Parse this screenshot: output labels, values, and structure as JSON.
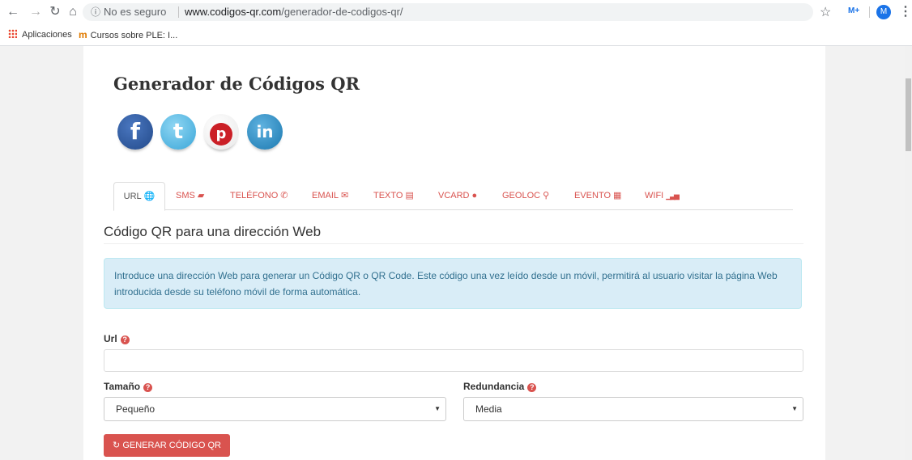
{
  "browser": {
    "security_label": "No es seguro",
    "url_host": "www.codigos-qr.com",
    "url_path": "/generador-de-codigos-qr/",
    "avatar_letter": "M",
    "bookmarks": [
      {
        "label": "Aplicaciones",
        "icon": "apps-icon"
      },
      {
        "label": "Cursos sobre PLE: I...",
        "icon": "ple-icon"
      }
    ]
  },
  "page": {
    "title": "Generador de Códigos QR",
    "social": [
      "facebook-icon",
      "twitter-icon",
      "pinterest-icon",
      "linkedin-icon"
    ],
    "tabs": [
      {
        "label": "URL",
        "icon": "globe-icon",
        "glyph": "🌐",
        "active": true
      },
      {
        "label": "SMS",
        "icon": "comment-icon",
        "glyph": "▰"
      },
      {
        "label": "TELÉFONO",
        "icon": "phone-icon",
        "glyph": "✆"
      },
      {
        "label": "EMAIL",
        "icon": "envelope-icon",
        "glyph": "✉"
      },
      {
        "label": "TEXTO",
        "icon": "list-icon",
        "glyph": "▤"
      },
      {
        "label": "VCARD",
        "icon": "user-icon",
        "glyph": "●"
      },
      {
        "label": "GEOLOC",
        "icon": "map-marker-icon",
        "glyph": "⚲"
      },
      {
        "label": "EVENTO",
        "icon": "calendar-icon",
        "glyph": "▦"
      },
      {
        "label": "WIFI",
        "icon": "signal-icon",
        "glyph": "▁▃▅"
      }
    ],
    "section_title": "Código QR para una dirección Web",
    "info_text": "Introduce una dirección Web para generar un Código QR o QR Code. Este código una vez leído desde un móvil, permitirá al usuario visitar la página Web introducida desde su teléfono móvil de forma automática.",
    "url_label": "Url",
    "url_value": "",
    "size_label": "Tamaño",
    "size_value": "Pequeño",
    "redundancy_label": "Redundancia",
    "redundancy_value": "Media",
    "generate_button": "GENERAR CÓDIGO QR",
    "accent_color": "#d9534f"
  }
}
